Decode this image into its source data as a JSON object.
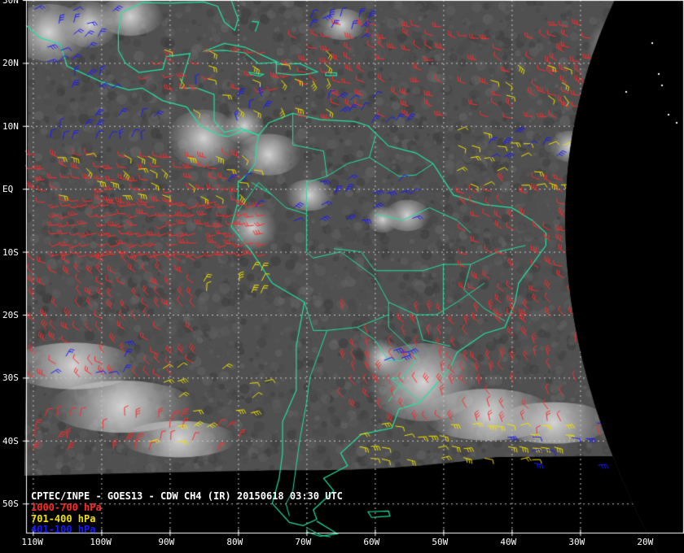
{
  "title": "CPTEC/INPE - GOES13 - CDW CH4 (IR) 20150618 03:30 UTC",
  "legend": [
    {
      "label": "1000-700 hPa",
      "color": "#ff2a2a"
    },
    {
      "label": "701-400 hPa",
      "color": "#f2e000"
    },
    {
      "label": "401-100 hPa",
      "color": "#1a1aff"
    }
  ],
  "lat_labels": [
    "30N",
    "20N",
    "10N",
    "EQ",
    "10S",
    "20S",
    "30S",
    "40S",
    "50S"
  ],
  "lon_labels": [
    "110W",
    "100W",
    "90W",
    "80W",
    "70W",
    "60W",
    "50W",
    "40W",
    "30W",
    "20W"
  ],
  "colors": {
    "coast": "#22e0a0",
    "grid": "#c8c8c8",
    "disk": "#4a4a4a",
    "space": "#000000",
    "frame": "#ffffff"
  }
}
